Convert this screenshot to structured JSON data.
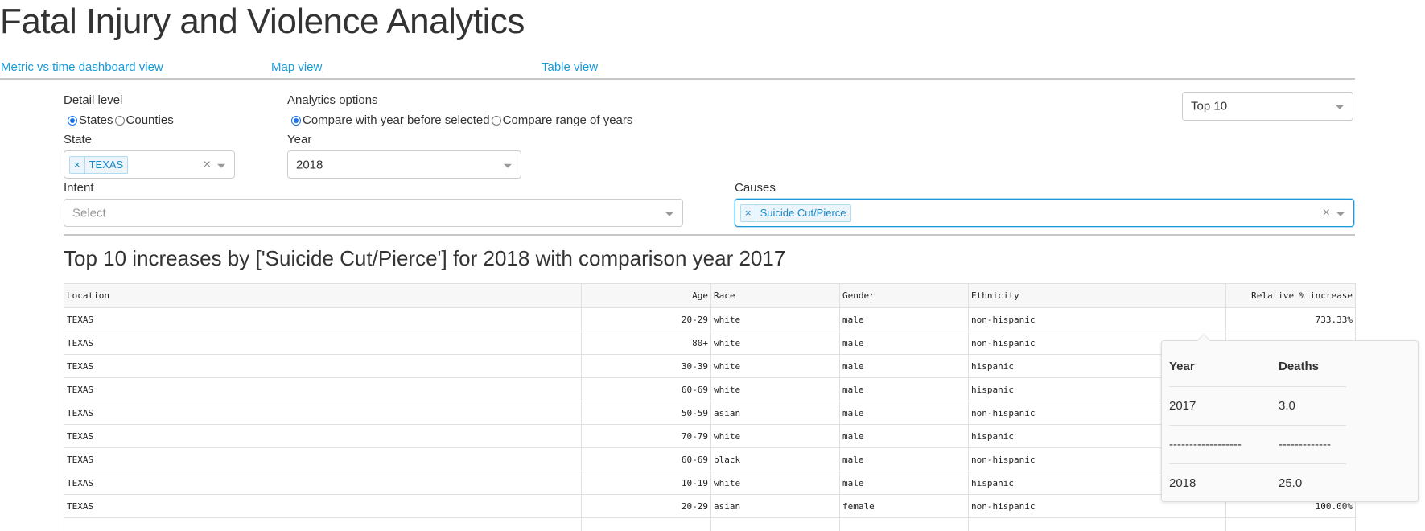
{
  "page": {
    "title": "Fatal Injury and Violence Analytics"
  },
  "nav": {
    "links": [
      {
        "label": "Metric vs time dashboard view"
      },
      {
        "label": "Map view"
      },
      {
        "label": "Table view"
      }
    ]
  },
  "controls": {
    "detail_level": {
      "label": "Detail level",
      "options": [
        "States",
        "Counties"
      ],
      "selected": "States"
    },
    "analytics_options": {
      "label": "Analytics options",
      "options": [
        "Compare with year before selected",
        "Compare range of years"
      ],
      "selected": "Compare with year before selected"
    },
    "top_n": {
      "value": "Top 10"
    },
    "state": {
      "label": "State",
      "selected_tags": [
        "TEXAS"
      ],
      "clear_icon": "close-icon",
      "dropdown_icon": "chevron-down-icon"
    },
    "year": {
      "label": "Year",
      "value": "2018"
    },
    "intent": {
      "label": "Intent",
      "placeholder": "Select"
    },
    "causes": {
      "label": "Causes",
      "selected_tags": [
        "Suicide Cut/Pierce"
      ]
    },
    "tag_remove_glyph": "×",
    "clear_glyph": "×"
  },
  "results": {
    "title": "Top 10 increases by ['Suicide Cut/Pierce'] for 2018 with comparison year 2017",
    "columns": [
      "Location",
      "Age",
      "Race",
      "Gender",
      "Ethnicity",
      "Relative % increase"
    ],
    "rows": [
      [
        "TEXAS",
        "20-29",
        "white",
        "male",
        "non-hispanic",
        "733.33%"
      ],
      [
        "TEXAS",
        "80+",
        "white",
        "male",
        "non-hispanic",
        ""
      ],
      [
        "TEXAS",
        "30-39",
        "white",
        "male",
        "hispanic",
        ""
      ],
      [
        "TEXAS",
        "60-69",
        "white",
        "male",
        "hispanic",
        ""
      ],
      [
        "TEXAS",
        "50-59",
        "asian",
        "male",
        "non-hispanic",
        ""
      ],
      [
        "TEXAS",
        "70-79",
        "white",
        "male",
        "hispanic",
        ""
      ],
      [
        "TEXAS",
        "60-69",
        "black",
        "male",
        "non-hispanic",
        ""
      ],
      [
        "TEXAS",
        "10-19",
        "white",
        "male",
        "hispanic",
        ""
      ],
      [
        "TEXAS",
        "20-29",
        "asian",
        "female",
        "non-hispanic",
        "100.00%"
      ],
      [
        "",
        "",
        "",
        "",
        "",
        ""
      ]
    ]
  },
  "tooltip": {
    "headers": [
      "Year",
      "Deaths"
    ],
    "rows": [
      [
        "2017",
        "3.0"
      ],
      [
        "------------------",
        "-------------"
      ],
      [
        "2018",
        "25.0"
      ]
    ]
  },
  "colors": {
    "link": "#1a9ad6",
    "tag_text": "#1a8ac8",
    "tag_bg": "#ebf5fb",
    "focus_border": "#1a9ad6",
    "radio_checked": "#1a73e8"
  }
}
